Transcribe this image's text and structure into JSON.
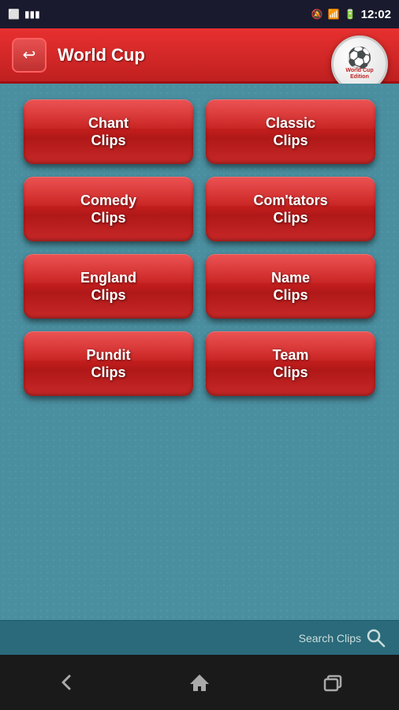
{
  "status_bar": {
    "time": "12:02"
  },
  "header": {
    "title": "World Cup",
    "back_label": "←",
    "badge_text": "World Cup Edition"
  },
  "buttons": [
    {
      "id": "chant-clips",
      "label": "Chant\nClips"
    },
    {
      "id": "classic-clips",
      "label": "Classic\nClips"
    },
    {
      "id": "comedy-clips",
      "label": "Comedy\nClips"
    },
    {
      "id": "commentators-clips",
      "label": "Com'tators\nClips"
    },
    {
      "id": "england-clips",
      "label": "England\nClips"
    },
    {
      "id": "name-clips",
      "label": "Name\nClips"
    },
    {
      "id": "pundit-clips",
      "label": "Pundit\nClips"
    },
    {
      "id": "team-clips",
      "label": "Team\nClips"
    }
  ],
  "search": {
    "label": "Search Clips"
  }
}
